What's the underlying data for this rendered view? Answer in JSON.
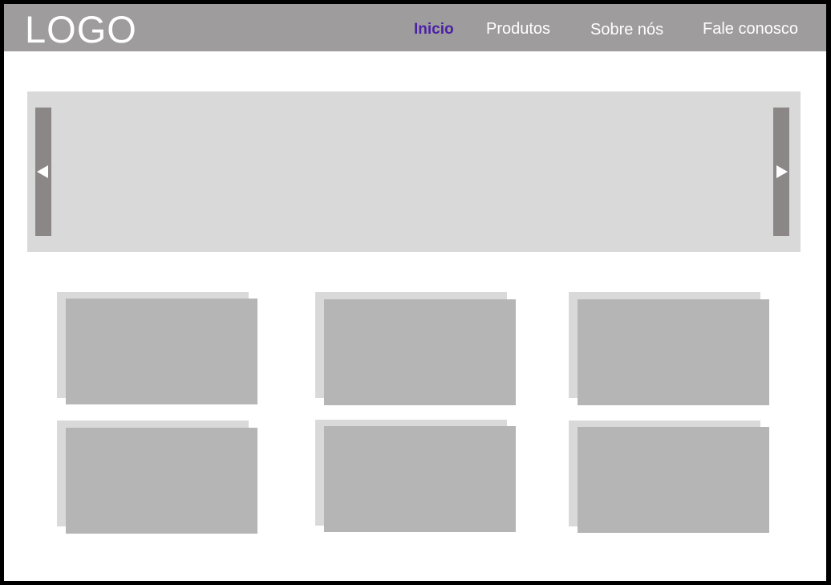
{
  "header": {
    "logo_text": "LOGO",
    "background_color": "#9e9c9c",
    "nav": [
      {
        "label": "Inicio",
        "active": true,
        "color": "#4b21a6"
      },
      {
        "label": "Produtos",
        "active": false
      },
      {
        "label": "Sobre nós",
        "active": false
      },
      {
        "label": "Fale conosco",
        "active": false
      }
    ]
  },
  "carousel": {
    "prev_icon": "left-triangle-arrow",
    "next_icon": "right-triangle-arrow",
    "background_color": "#d9d9d9",
    "button_color": "#8b8787"
  },
  "cards": {
    "count": 6,
    "placeholder_color": "#b5b5b5",
    "shadow_color": "#d9d9d9"
  }
}
